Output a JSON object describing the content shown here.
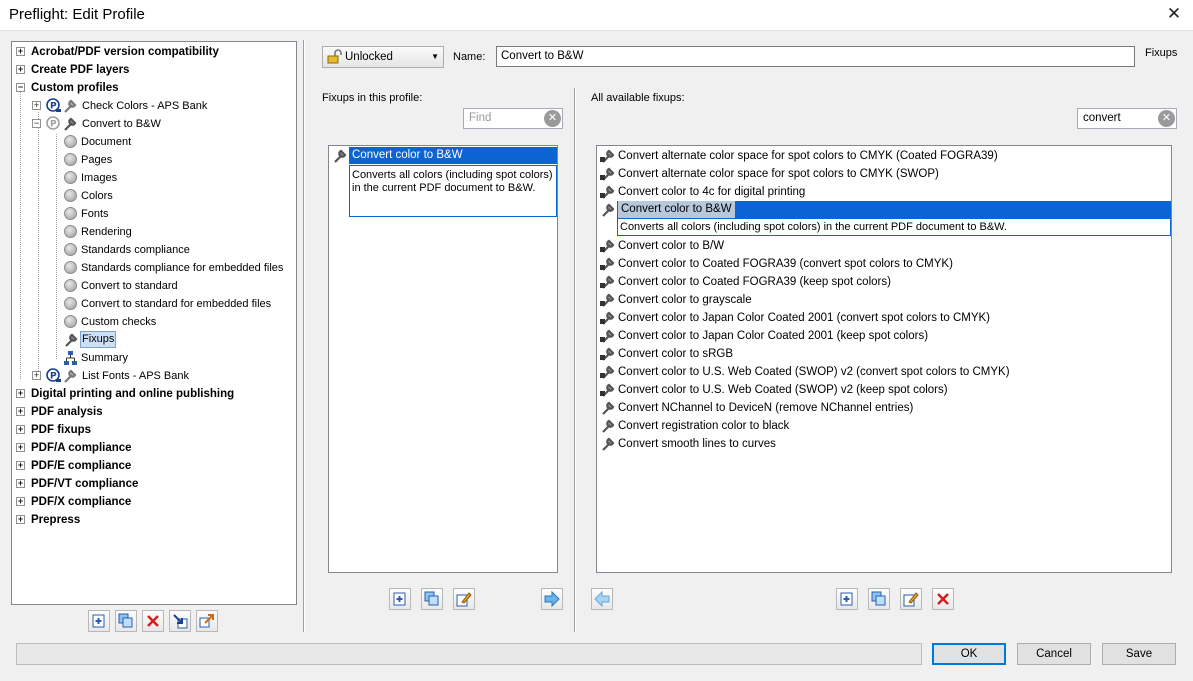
{
  "window": {
    "title": "Preflight: Edit Profile",
    "close_glyph": "✕"
  },
  "tree": {
    "top_groups_before": [
      "Acrobat/PDF version compatibility",
      "Create PDF layers",
      "Custom profiles"
    ],
    "custom_children": [
      "Check Colors - APS Bank",
      "Convert to B&W"
    ],
    "bw_children": [
      "Document",
      "Pages",
      "Images",
      "Colors",
      "Fonts",
      "Rendering",
      "Standards compliance",
      "Standards compliance for embedded files",
      "Convert to standard",
      "Convert to standard for embedded files",
      "Custom checks",
      "Fixups",
      "Summary"
    ],
    "after_custom": "List Fonts - APS Bank",
    "top_groups_after": [
      "Digital printing and online publishing",
      "PDF analysis",
      "PDF fixups",
      "PDF/A compliance",
      "PDF/E compliance",
      "PDF/VT compliance",
      "PDF/X compliance",
      "Prepress"
    ]
  },
  "header": {
    "lock_state": "Unlocked",
    "name_label": "Name:",
    "name_value": "Convert to B&W",
    "section": "Fixups"
  },
  "profile_fixups": {
    "label": "Fixups in this profile:",
    "find_placeholder": "Find",
    "items": [
      {
        "name": "Convert color to B&W",
        "description": "Converts all colors (including spot colors) in the current PDF document to B&W."
      }
    ]
  },
  "available_fixups": {
    "label": "All available fixups:",
    "search_value": "convert",
    "items": [
      "Convert alternate color space for spot colors to CMYK (Coated FOGRA39)",
      "Convert alternate color space for spot colors to CMYK (SWOP)",
      "Convert color to 4c for digital printing",
      "Convert color to B&W",
      "Convert color to B/W",
      "Convert color to Coated FOGRA39 (convert spot colors to CMYK)",
      "Convert color to Coated FOGRA39 (keep spot colors)",
      "Convert color to grayscale",
      "Convert color to Japan Color Coated 2001 (convert spot colors to CMYK)",
      "Convert color to Japan Color Coated 2001 (keep spot colors)",
      "Convert color to sRGB",
      "Convert color to U.S. Web Coated (SWOP) v2  (convert spot colors to CMYK)",
      "Convert color to U.S. Web Coated (SWOP) v2 (keep spot colors)",
      "Convert NChannel to DeviceN (remove NChannel entries)",
      "Convert registration color to black",
      "Convert smooth lines to curves"
    ],
    "selected_description": "Converts all colors (including spot colors) in the current PDF document to B&W."
  },
  "buttons": {
    "ok": "OK",
    "cancel": "Cancel",
    "save": "Save"
  },
  "colors": {
    "selection": "#0a64d2",
    "default_button_border": "#0078d7"
  }
}
